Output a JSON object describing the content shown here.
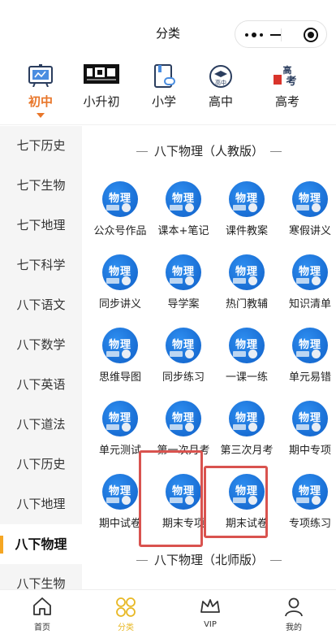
{
  "header": {
    "title": "分类"
  },
  "grade_tabs": [
    {
      "label": "初中",
      "active": true,
      "icon": "chalkboard-icon"
    },
    {
      "label": "小升初",
      "active": false,
      "icon": "xiaoshengchu-logo-icon"
    },
    {
      "label": "小学",
      "active": false,
      "icon": "book-icon"
    },
    {
      "label": "高中",
      "active": false,
      "icon": "gaozhong-badge-icon"
    },
    {
      "label": "高考",
      "active": false,
      "icon": "gaokao-logo-icon"
    }
  ],
  "gaozhong_badge_text": "高中",
  "gaokao_logo_text": {
    "top": "高",
    "bottom": "考"
  },
  "sidebar": {
    "items": [
      {
        "label": "七下历史",
        "active": false
      },
      {
        "label": "七下生物",
        "active": false
      },
      {
        "label": "七下地理",
        "active": false
      },
      {
        "label": "七下科学",
        "active": false
      },
      {
        "label": "八下语文",
        "active": false
      },
      {
        "label": "八下数学",
        "active": false
      },
      {
        "label": "八下英语",
        "active": false
      },
      {
        "label": "八下道法",
        "active": false
      },
      {
        "label": "八下历史",
        "active": false
      },
      {
        "label": "八下地理",
        "active": false
      },
      {
        "label": "八下物理",
        "active": true
      },
      {
        "label": "八下生物",
        "active": false
      }
    ]
  },
  "main": {
    "section1_title": "八下物理（人教版）",
    "section2_title": "八下物理（北师版）",
    "icon_text": "物理",
    "items": [
      {
        "label": "公众号作品"
      },
      {
        "label": "课本+笔记"
      },
      {
        "label": "课件教案"
      },
      {
        "label": "寒假讲义"
      },
      {
        "label": "同步讲义"
      },
      {
        "label": "导学案"
      },
      {
        "label": "热门教辅"
      },
      {
        "label": "知识清单"
      },
      {
        "label": "思维导图"
      },
      {
        "label": "同步练习"
      },
      {
        "label": "一课一练"
      },
      {
        "label": "单元易错"
      },
      {
        "label": "单元测试"
      },
      {
        "label": "第一次月考"
      },
      {
        "label": "第三次月考"
      },
      {
        "label": "期中专项"
      },
      {
        "label": "期中试卷"
      },
      {
        "label": "期末专项"
      },
      {
        "label": "期末试卷"
      },
      {
        "label": "专项练习"
      }
    ],
    "highlighted": [
      "期末专项",
      "期末试卷"
    ],
    "highlight_color": "#d9534f"
  },
  "bottom_nav": [
    {
      "label": "首页",
      "icon": "home-icon",
      "active": false
    },
    {
      "label": "分类",
      "icon": "category-icon",
      "active": true
    },
    {
      "label": "VIP",
      "icon": "crown-icon",
      "active": false
    },
    {
      "label": "我的",
      "icon": "user-icon",
      "active": false
    }
  ],
  "colors": {
    "accent": "#e8762a",
    "active_nav": "#e8b825",
    "sidebar_bg": "#f5f5f5",
    "icon_blue": "#1a73e0"
  }
}
